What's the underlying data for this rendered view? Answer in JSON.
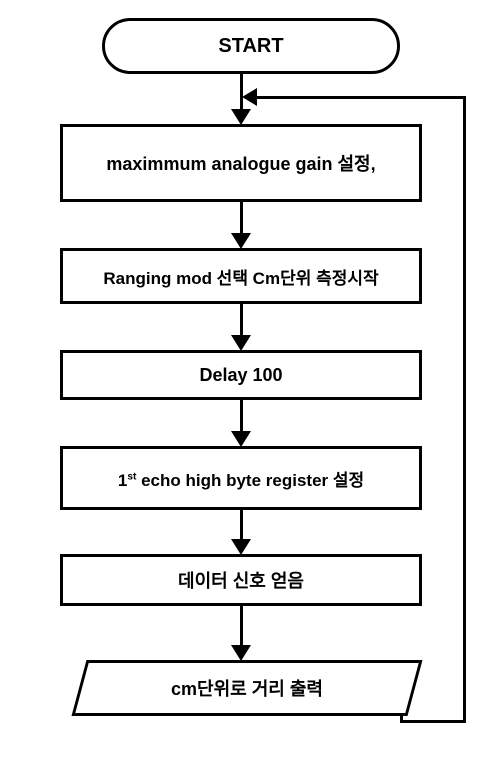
{
  "chart_data": {
    "type": "flowchart",
    "nodes": [
      {
        "id": "start",
        "shape": "terminator",
        "label": "START"
      },
      {
        "id": "step1",
        "shape": "process",
        "label": "maximmum analogue gain 설정,"
      },
      {
        "id": "step2",
        "shape": "process",
        "label": "Ranging mod 선택  Cm단위 측정시작"
      },
      {
        "id": "step3",
        "shape": "process",
        "label": "Delay 100"
      },
      {
        "id": "step4",
        "shape": "process",
        "label": "1st echo high byte register 설정"
      },
      {
        "id": "step5",
        "shape": "process",
        "label": "데이터 신호 얻음"
      },
      {
        "id": "output",
        "shape": "parallelogram",
        "label": "cm단위로 거리 출력"
      }
    ],
    "edges": [
      {
        "from": "start",
        "to": "step1"
      },
      {
        "from": "step1",
        "to": "step2"
      },
      {
        "from": "step2",
        "to": "step3"
      },
      {
        "from": "step3",
        "to": "step4"
      },
      {
        "from": "step4",
        "to": "step5"
      },
      {
        "from": "step5",
        "to": "output"
      },
      {
        "from": "output",
        "to": "step1",
        "loop_back": true
      }
    ]
  }
}
